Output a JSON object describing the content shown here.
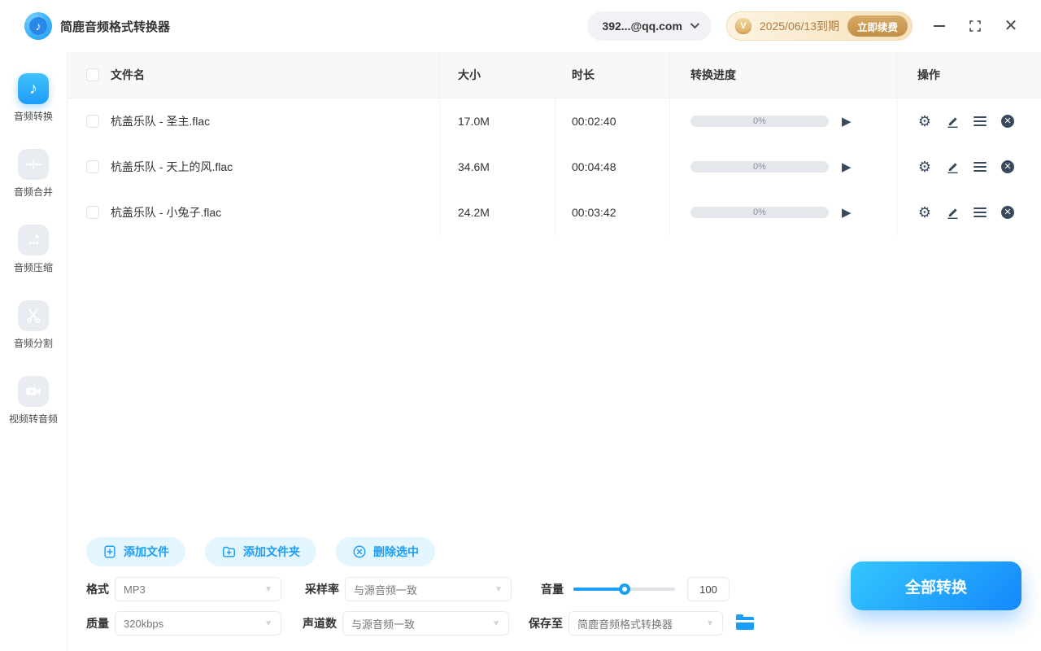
{
  "app": {
    "title": "简鹿音频格式转换器",
    "account": "392...@qq.com",
    "expiry": "2025/06/13到期",
    "renew_label": "立即续费",
    "vip_badge": "V"
  },
  "sidebar": {
    "items": [
      {
        "label": "音频转换",
        "icon": "music-note-icon",
        "active": true
      },
      {
        "label": "音频合并",
        "icon": "merge-icon",
        "active": false
      },
      {
        "label": "音频压缩",
        "icon": "compress-icon",
        "active": false
      },
      {
        "label": "音频分割",
        "icon": "scissors-icon",
        "active": false
      },
      {
        "label": "视频转音频",
        "icon": "video-camera-icon",
        "active": false
      }
    ]
  },
  "table": {
    "headers": {
      "name": "文件名",
      "size": "大小",
      "duration": "时长",
      "progress": "转换进度",
      "actions": "操作"
    },
    "rows": [
      {
        "name": "杭盖乐队 - 圣主.flac",
        "size": "17.0M",
        "duration": "00:02:40",
        "progress": "0%"
      },
      {
        "name": "杭盖乐队 - 天上的风.flac",
        "size": "34.6M",
        "duration": "00:04:48",
        "progress": "0%"
      },
      {
        "name": "杭盖乐队 - 小兔子.flac",
        "size": "24.2M",
        "duration": "00:03:42",
        "progress": "0%"
      }
    ],
    "row_action_icons": [
      "settings-gear-icon",
      "edit-pencil-icon",
      "menu-icon",
      "remove-icon"
    ]
  },
  "toolbar": {
    "add_file": "添加文件",
    "add_folder": "添加文件夹",
    "delete_selected": "删除选中"
  },
  "settings": {
    "format_label": "格式",
    "format_value": "MP3",
    "sample_rate_label": "采样率",
    "sample_rate_value": "与源音频一致",
    "volume_label": "音量",
    "volume_value": "100",
    "quality_label": "质量",
    "quality_value": "320kbps",
    "channels_label": "声道数",
    "channels_value": "与源音频一致",
    "save_to_label": "保存至",
    "save_to_value": "简鹿音频格式转换器"
  },
  "convert_all_label": "全部转换",
  "colors": {
    "accent_blue": "#1b9ef7",
    "convert_gradient_start": "#35c6fd",
    "convert_gradient_end": "#1488fc",
    "action_icon_slate": "#3a4a5e",
    "renew_gold": "#c28e43",
    "expiry_text_gold": "#ad7c3e"
  }
}
